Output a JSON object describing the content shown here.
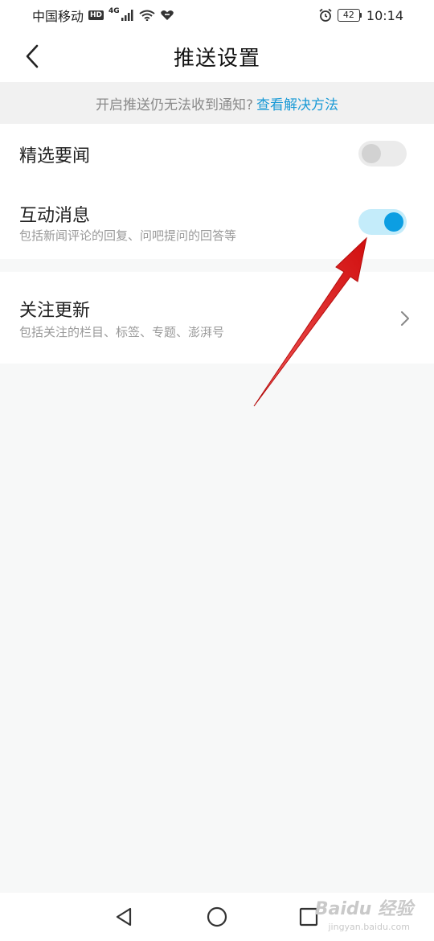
{
  "status_bar": {
    "carrier": "中国移动",
    "hd": "HD",
    "network": "4G",
    "battery": "42",
    "time": "10:14"
  },
  "header": {
    "title": "推送设置",
    "back_icon": "chevron-left-icon"
  },
  "notice": {
    "text": "开启推送仍无法收到通知?",
    "link": "查看解决方法",
    "link_color": "#1a9ad6"
  },
  "settings": {
    "featured_news": {
      "label": "精选要闻",
      "enabled": false
    },
    "interactive_messages": {
      "label": "互动消息",
      "description": "包括新闻评论的回复、问吧提问的回答等",
      "enabled": true
    },
    "follow_updates": {
      "label": "关注更新",
      "description": "包括关注的栏目、标签、专题、澎湃号"
    }
  },
  "colors": {
    "toggle_on_track": "#c4ecfa",
    "toggle_on_knob": "#0c9ee2",
    "toggle_off_track": "#ebebeb",
    "annotation_arrow": "#e01b1b"
  },
  "system_nav": {
    "back": "triangle-back-icon",
    "home": "circle-home-icon",
    "recents": "square-recents-icon"
  },
  "watermark": {
    "text": "Baidu 经验",
    "sub": "jingyan.baidu.com"
  }
}
